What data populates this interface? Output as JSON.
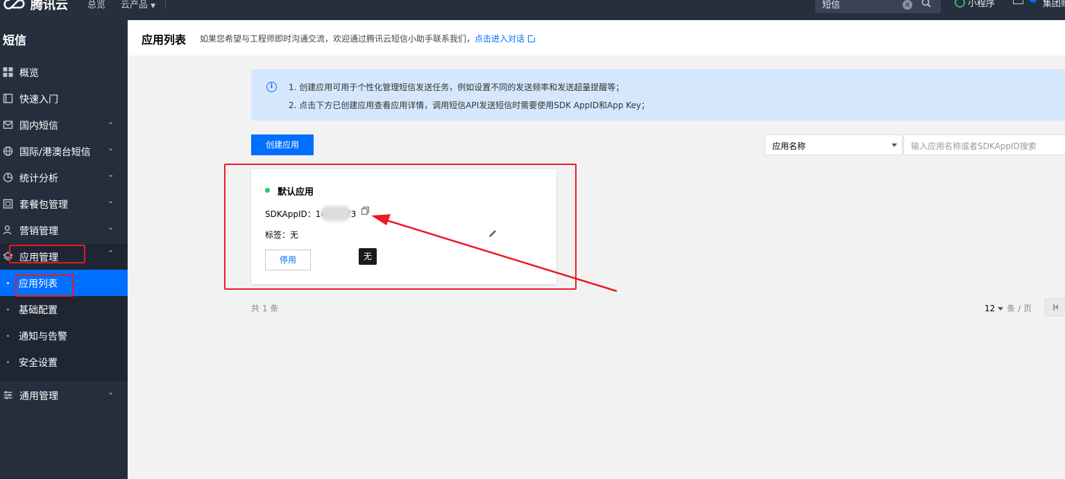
{
  "topbar": {
    "brand": "腾讯云",
    "nav": [
      "总览",
      "云产品"
    ],
    "search_value": "短信",
    "mini_program": "小程序",
    "group_account": "集团账号"
  },
  "sidebar": {
    "title": "短信",
    "items": [
      {
        "label": "概览",
        "icon": "dashboard-icon",
        "chevron": false
      },
      {
        "label": "快速入门",
        "icon": "book-icon",
        "chevron": false
      },
      {
        "label": "国内短信",
        "icon": "mail-icon",
        "chevron": true
      },
      {
        "label": "国际/港澳台短信",
        "icon": "globe-icon",
        "chevron": true
      },
      {
        "label": "统计分析",
        "icon": "pie-chart-icon",
        "chevron": true
      },
      {
        "label": "套餐包管理",
        "icon": "package-icon",
        "chevron": true
      },
      {
        "label": "营销管理",
        "icon": "users-icon",
        "chevron": true
      },
      {
        "label": "应用管理",
        "icon": "layers-icon",
        "chevron": "up"
      }
    ],
    "sub_items": [
      "应用列表",
      "基础配置",
      "通知与告警",
      "安全设置"
    ],
    "bottom_item": {
      "label": "通用管理",
      "icon": "sliders-icon"
    }
  },
  "header": {
    "title": "应用列表",
    "desc": "如果您希望与工程师即时沟通交流，欢迎通过腾讯云短信小助手联系我们，",
    "link": "点击进入对话"
  },
  "tip": {
    "lines": [
      "1. 创建应用可用于个性化管理短信发送任务，例如设置不同的发送频率和发送超量提醒等；",
      "2. 点击下方已创建应用查看应用详情，调用短信API发送短信时需要使用SDK AppID和App Key；"
    ]
  },
  "toolbar": {
    "create_label": "创建应用",
    "filter_select": "应用名称",
    "search_placeholder": "输入应用名称或者SDKAppID搜索"
  },
  "card": {
    "title": "默认应用",
    "status_color": "#29cc6a",
    "sdk_label": "SDKAppID：",
    "sdk_prefix": "14",
    "sdk_suffix": "73",
    "tag_label": "标签：",
    "tag_value": "无",
    "stop_label": "停用"
  },
  "tooltip": "无",
  "pagination": {
    "total": "共 1 条",
    "page_size": "12",
    "page_size_unit": "条 / 页"
  },
  "colors": {
    "accent": "#006eff",
    "sidebar_bg": "#252e3c",
    "annotation": "#e81b23"
  }
}
